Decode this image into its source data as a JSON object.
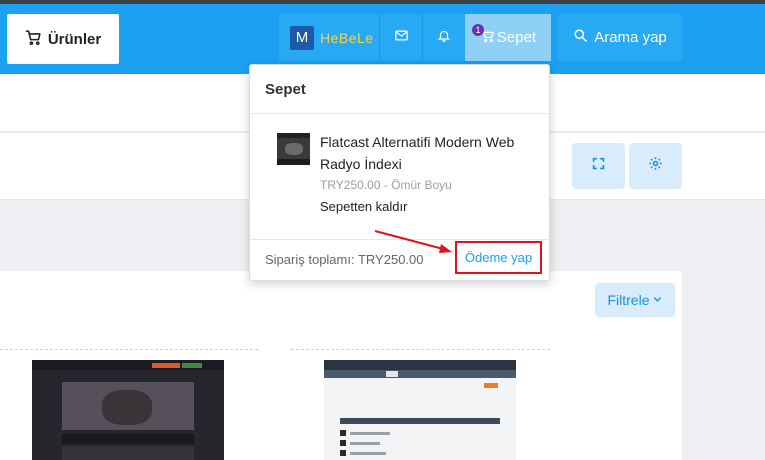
{
  "header": {
    "products_label": "Ürünler",
    "user": {
      "avatar_letter": "M",
      "name": "HeBeLe"
    },
    "cart": {
      "label": "Sepet",
      "count": "1"
    },
    "search_label": "Arama yap"
  },
  "cart_dropdown": {
    "title": "Sepet",
    "item": {
      "name": "Flatcast Alternatifi Modern Web Radyo İndexi",
      "price": "TRY250.00 - Ömür Boyu",
      "remove_label": "Sepetten kaldır"
    },
    "total": "Sipariş toplamı: TRY250.00",
    "checkout_label": "Ödeme yap"
  },
  "toolbar": {
    "filter_label": "Filtrele"
  },
  "colors": {
    "brand": "#1ba0f2",
    "highlight": "#e0121b",
    "username": "#f4d64a"
  }
}
